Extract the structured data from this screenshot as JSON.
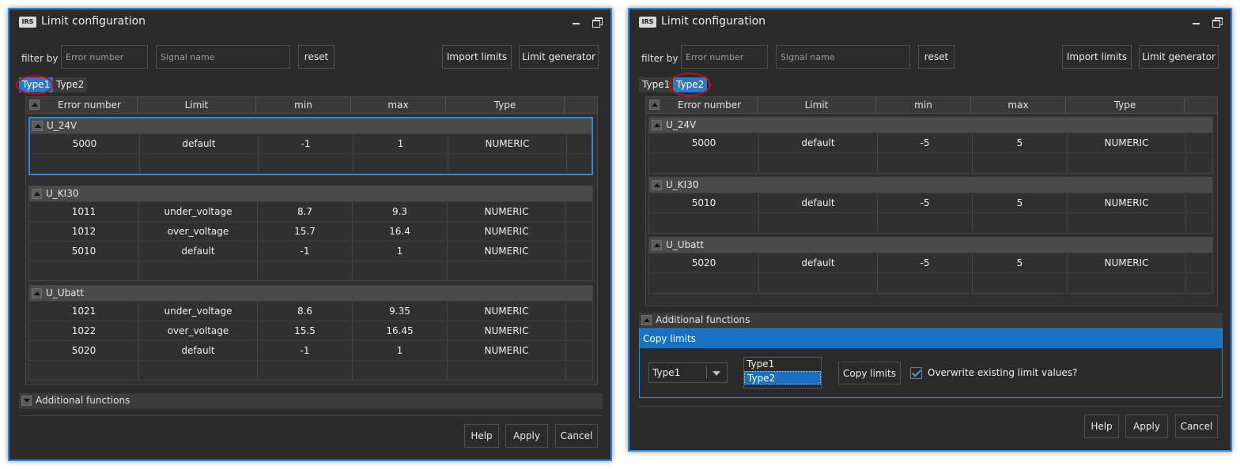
{
  "colors": {
    "accent": "#2d8ad8",
    "highlight_ring": "#b3121b",
    "background": "#2b2b2b"
  },
  "windows": [
    {
      "title": "Limit configuration",
      "logo_text": "IRS",
      "filter_label": "filter by",
      "error_placeholder": "Error number",
      "signal_placeholder": "Signal name",
      "reset_label": "reset",
      "import_label": "Import limits",
      "generator_label": "Limit generator",
      "tabs": [
        {
          "label": "Type1",
          "active": true
        },
        {
          "label": "Type2",
          "active": false
        }
      ],
      "columns": [
        "Error number",
        "Limit",
        "min",
        "max",
        "Type"
      ],
      "groups": [
        {
          "name": "U_24V",
          "rows": [
            [
              "5000",
              "default",
              "-1",
              "1",
              "NUMERIC"
            ]
          ]
        },
        {
          "name": "U_KI30",
          "rows": [
            [
              "1011",
              "under_voltage",
              "8.7",
              "9.3",
              "NUMERIC"
            ],
            [
              "1012",
              "over_voltage",
              "15.7",
              "16.4",
              "NUMERIC"
            ],
            [
              "5010",
              "default",
              "-1",
              "1",
              "NUMERIC"
            ]
          ]
        },
        {
          "name": "U_Ubatt",
          "rows": [
            [
              "1021",
              "under_voltage",
              "8.6",
              "9.35",
              "NUMERIC"
            ],
            [
              "1022",
              "over_voltage",
              "15.5",
              "16.45",
              "NUMERIC"
            ],
            [
              "5020",
              "default",
              "-1",
              "1",
              "NUMERIC"
            ]
          ]
        }
      ],
      "additional_functions_label": "Additional functions",
      "help_label": "Help",
      "apply_label": "Apply",
      "cancel_label": "Cancel"
    },
    {
      "title": "Limit configuration",
      "logo_text": "IRS",
      "filter_label": "filter by",
      "error_placeholder": "Error number",
      "signal_placeholder": "Signal name",
      "reset_label": "reset",
      "import_label": "Import limits",
      "generator_label": "Limit generator",
      "tabs": [
        {
          "label": "Type1",
          "active": false
        },
        {
          "label": "Type2",
          "active": true
        }
      ],
      "columns": [
        "Error number",
        "Limit",
        "min",
        "max",
        "Type"
      ],
      "groups": [
        {
          "name": "U_24V",
          "rows": [
            [
              "5000",
              "default",
              "-5",
              "5",
              "NUMERIC"
            ]
          ]
        },
        {
          "name": "U_KI30",
          "rows": [
            [
              "5010",
              "default",
              "-5",
              "5",
              "NUMERIC"
            ]
          ]
        },
        {
          "name": "U_Ubatt",
          "rows": [
            [
              "5020",
              "default",
              "-5",
              "5",
              "NUMERIC"
            ]
          ]
        }
      ],
      "additional_functions_label": "Additional functions",
      "copy_limits": {
        "header": "Copy limits",
        "source_value": "Type1",
        "targets": [
          {
            "label": "Type1",
            "selected": false
          },
          {
            "label": "Type2",
            "selected": true
          }
        ],
        "button_label": "Copy limits",
        "overwrite_label": "Overwrite existing limit values?",
        "overwrite_checked": true
      },
      "help_label": "Help",
      "apply_label": "Apply",
      "cancel_label": "Cancel"
    }
  ]
}
